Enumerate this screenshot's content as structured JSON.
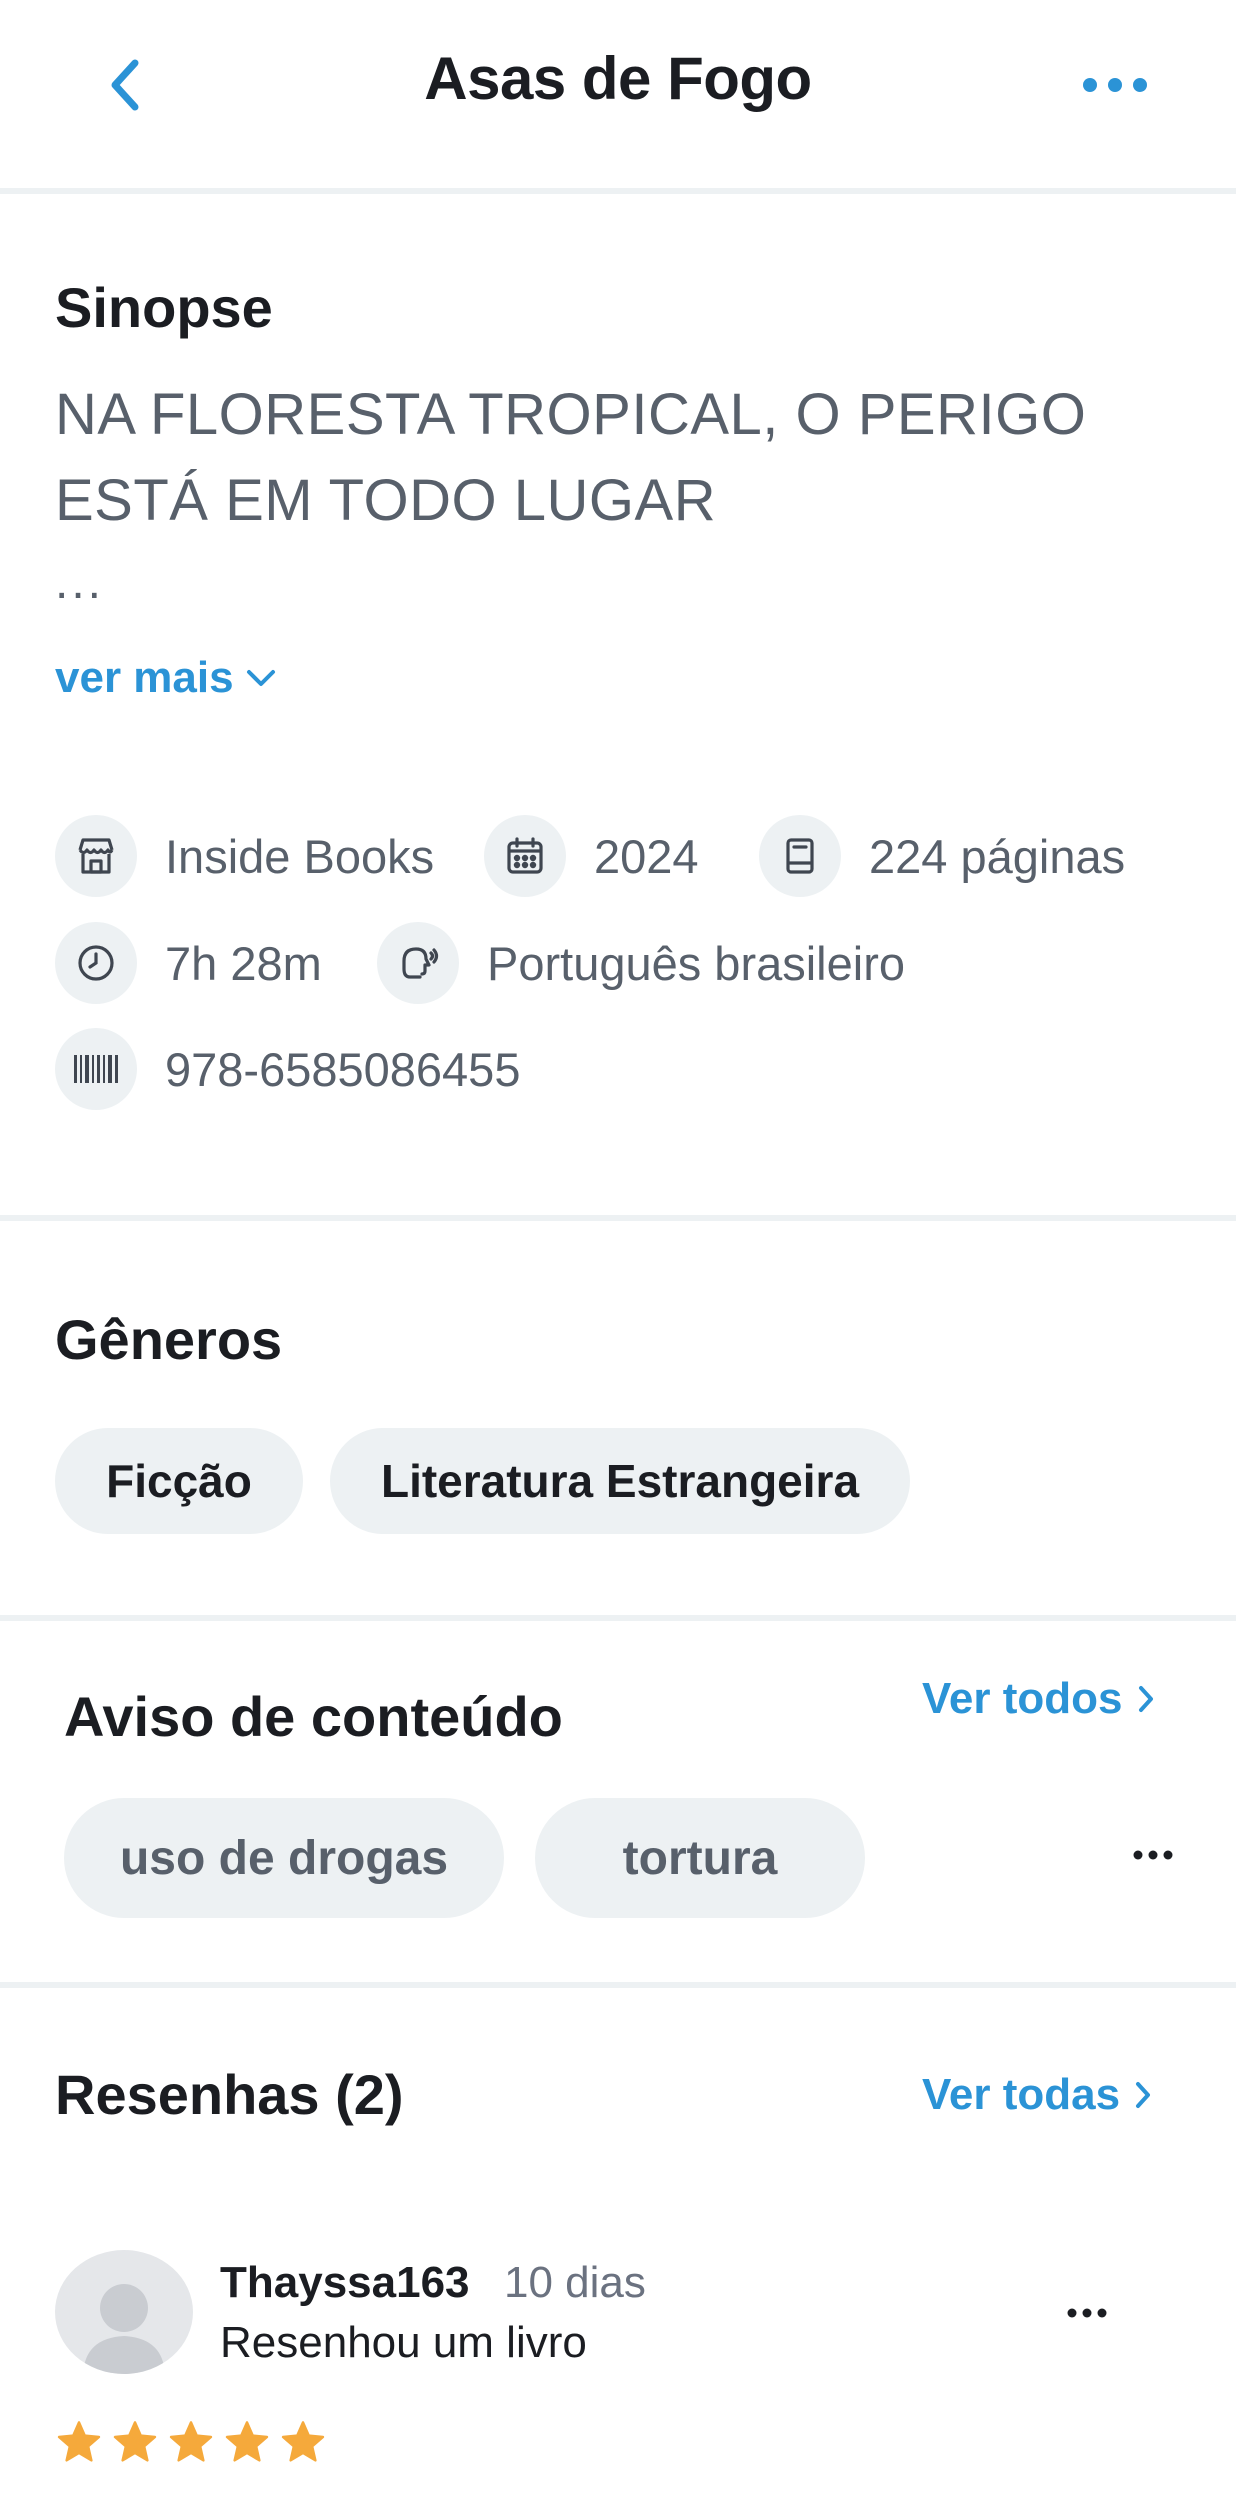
{
  "header": {
    "title": "Asas de Fogo",
    "back_icon": "chevron-left-icon",
    "more_icon": "more-horizontal-icon"
  },
  "synopsis": {
    "heading": "Sinopse",
    "text": "NA FLORESTA TROPICAL, O PERIGO ESTÁ EM TODO LUGAR",
    "ellipsis": "...",
    "see_more": "ver mais"
  },
  "details": {
    "publisher": "Inside Books",
    "year": "2024",
    "pages": "224 páginas",
    "duration": "7h 28m",
    "language": "Português brasileiro",
    "isbn": "978-6585086455"
  },
  "genres": {
    "heading": "Gêneros",
    "items": [
      "Ficção",
      "Literatura Estrangeira"
    ]
  },
  "content_warning": {
    "heading": "Aviso de conteúdo",
    "see_all": "Ver todos",
    "items": [
      "uso de drogas",
      "tortura"
    ]
  },
  "reviews": {
    "heading": "Resenhas (2)",
    "see_all": "Ver todas",
    "items": [
      {
        "username": "Thayssa163",
        "time_ago": "10 dias",
        "action": "Resenhou um livro",
        "rating": 5
      }
    ]
  },
  "colors": {
    "accent": "#2b93d6",
    "text_primary": "#1b1d22",
    "text_secondary": "#58606b",
    "chip_bg": "#edf1f3",
    "star": "#f5a93b"
  }
}
